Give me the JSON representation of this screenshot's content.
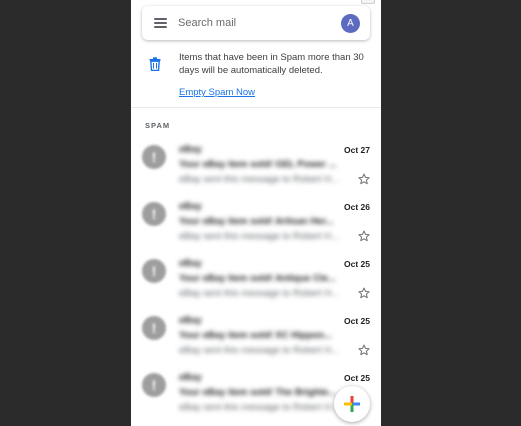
{
  "search": {
    "placeholder": "Search mail",
    "avatar_letter": "A"
  },
  "notice": {
    "text": "Items that have been in Spam more than 30 days will be automatically deleted.",
    "link_label": "Empty Spam Now"
  },
  "section_label": "SPAM",
  "emails": [
    {
      "avatar": "!",
      "sender": "eBay",
      "subject": "Your eBay item sold! GEL Power ...",
      "snippet": "eBay sent this message to Robert H...",
      "date": "Oct 27"
    },
    {
      "avatar": "!",
      "sender": "eBay",
      "subject": "Your eBay item sold! Artisan Her...",
      "snippet": "eBay sent this message to Robert H...",
      "date": "Oct 26"
    },
    {
      "avatar": "!",
      "sender": "eBay",
      "subject": "Your eBay item sold! Antique Cle...",
      "snippet": "eBay sent this message to Robert H...",
      "date": "Oct 25"
    },
    {
      "avatar": "!",
      "sender": "eBay",
      "subject": "Your eBay item sold! XC Hippon...",
      "snippet": "eBay sent this message to Robert H...",
      "date": "Oct 25"
    },
    {
      "avatar": "!",
      "sender": "eBay",
      "subject": "Your eBay item sold! The Brighte...",
      "snippet": "eBay sent this message to Robert H...",
      "date": "Oct 25"
    }
  ],
  "colors": {
    "link": "#1a73e8",
    "avatar": "#5c6bc0",
    "spam_avatar": "#9e9e9e",
    "background": "#2b2b2b"
  },
  "icons": {
    "menu": "menu-icon",
    "trash": "trash-icon",
    "star": "star-outline-icon",
    "compose": "compose-plus-icon"
  }
}
